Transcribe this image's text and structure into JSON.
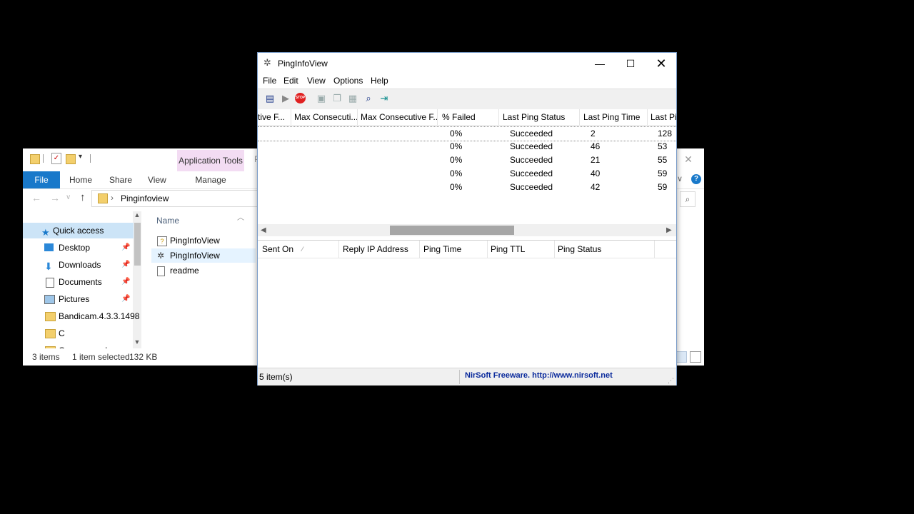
{
  "explorer": {
    "ribbon_contextual": "Application Tools",
    "ribbon_contextual_cut": "P",
    "tabs": {
      "file": "File",
      "home": "Home",
      "share": "Share",
      "view": "View",
      "manage": "Manage"
    },
    "address": {
      "path": "Pinginfoview"
    },
    "nav": [
      {
        "label": "Quick access",
        "pinned": false
      },
      {
        "label": "Desktop",
        "pinned": true
      },
      {
        "label": "Downloads",
        "pinned": true
      },
      {
        "label": "Documents",
        "pinned": true
      },
      {
        "label": "Pictures",
        "pinned": true
      },
      {
        "label": "Bandicam.4.3.3.1498",
        "pinned": false
      },
      {
        "label": "C",
        "pinned": false
      },
      {
        "label": "Compressed",
        "pinned": false
      }
    ],
    "name_header": "Name",
    "files": [
      {
        "name": "PingInfoView",
        "selected": false
      },
      {
        "name": "PingInfoView",
        "selected": true
      },
      {
        "name": "readme",
        "selected": false
      }
    ],
    "status": {
      "items": "3 items",
      "selected": "1 item selected",
      "size": "132 KB"
    },
    "help_glyph": "?"
  },
  "piv": {
    "title": "PingInfoView",
    "menu": {
      "file": "File",
      "edit": "Edit",
      "view": "View",
      "options": "Options",
      "help": "Help"
    },
    "columns": [
      "tive F...",
      "Max Consecuti...",
      "Max Consecutive F...",
      "% Failed",
      "Last Ping Status",
      "Last Ping Time",
      "Last Pi"
    ],
    "rows": [
      {
        "failed": "0%",
        "status": "Succeeded",
        "time": "2",
        "last": "128"
      },
      {
        "failed": "0%",
        "status": "Succeeded",
        "time": "46",
        "last": "53"
      },
      {
        "failed": "0%",
        "status": "Succeeded",
        "time": "21",
        "last": "55"
      },
      {
        "failed": "0%",
        "status": "Succeeded",
        "time": "40",
        "last": "59"
      },
      {
        "failed": "0%",
        "status": "Succeeded",
        "time": "42",
        "last": "59"
      }
    ],
    "lower_columns": {
      "sent_on": "Sent On",
      "reply_ip": "Reply IP Address",
      "ping_time": "Ping Time",
      "ping_ttl": "Ping TTL",
      "ping_status": "Ping Status"
    },
    "status": {
      "count": "5 item(s)",
      "link": "NirSoft Freeware.  http://www.nirsoft.net"
    },
    "colors": {
      "stop": "#e02020",
      "link": "#0a2a9c",
      "border": "#7a9cc8"
    }
  }
}
